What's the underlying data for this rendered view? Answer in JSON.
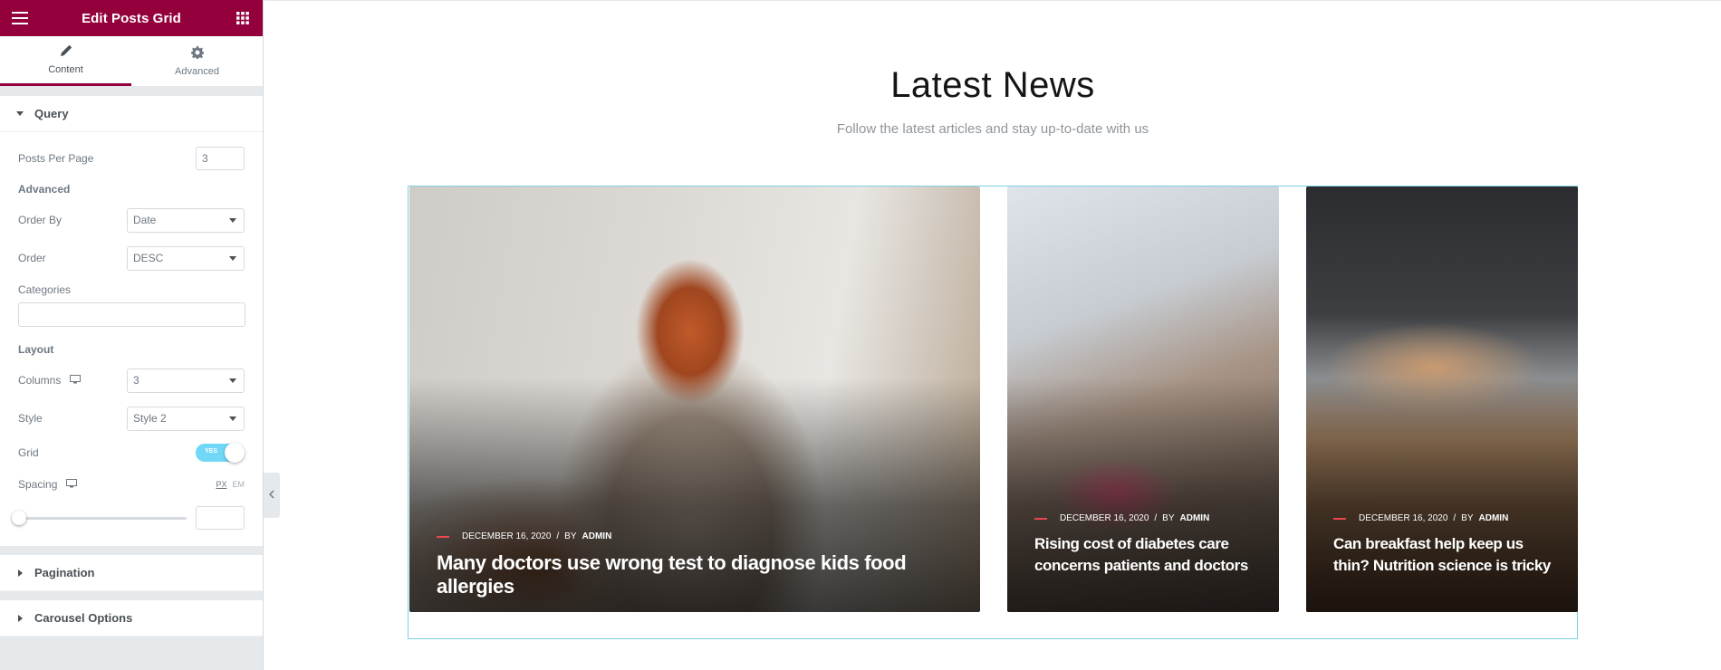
{
  "editor": {
    "title": "Edit Posts Grid",
    "tabs": [
      {
        "label": "Content",
        "icon": "pencil-icon",
        "active": true
      },
      {
        "label": "Advanced",
        "icon": "gear-icon",
        "active": false
      }
    ],
    "accent_color": "#93003c"
  },
  "query": {
    "heading": "Query",
    "posts_per_page_label": "Posts Per Page",
    "posts_per_page_value": "3",
    "advanced_heading": "Advanced",
    "order_by_label": "Order By",
    "order_by_value": "Date",
    "order_label": "Order",
    "order_value": "DESC",
    "categories_label": "Categories",
    "categories_value": ""
  },
  "layout": {
    "heading": "Layout",
    "columns_label": "Columns",
    "columns_value": "3",
    "style_label": "Style",
    "style_value": "Style 2",
    "grid_label": "Grid",
    "grid_toggle_text": "YES",
    "grid_enabled": true,
    "spacing_label": "Spacing",
    "unit_px": "PX",
    "unit_em": "EM",
    "spacing_value": ""
  },
  "sections": {
    "pagination": "Pagination",
    "carousel": "Carousel Options"
  },
  "preview": {
    "heading": "Latest News",
    "subtitle": "Follow the latest articles and stay up-to-date with us",
    "posts": [
      {
        "date": "DECEMBER 16, 2020",
        "by": "BY",
        "author": "ADMIN",
        "title": "Many doctors use wrong test to diagnose kids food allergies"
      },
      {
        "date": "DECEMBER 16, 2020",
        "by": "BY",
        "author": "ADMIN",
        "title": "Rising cost of diabetes care concerns patients and doctors"
      },
      {
        "date": "DECEMBER 16, 2020",
        "by": "BY",
        "author": "ADMIN",
        "title": "Can breakfast help keep us thin? Nutrition science is tricky"
      }
    ]
  }
}
